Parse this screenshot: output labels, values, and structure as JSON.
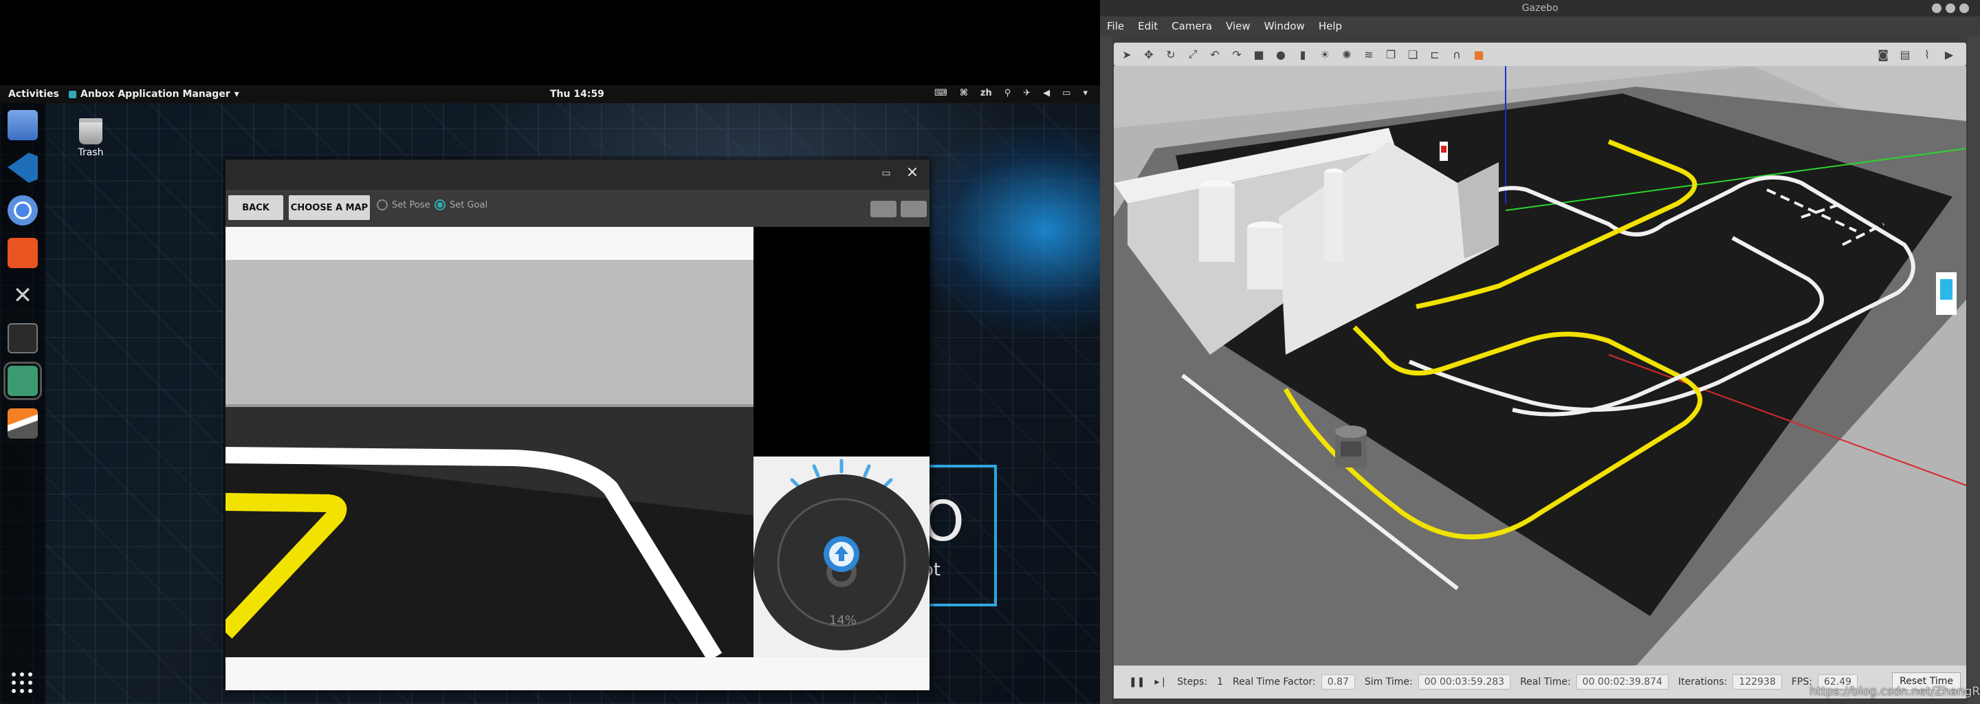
{
  "topbar": {
    "activities": "Activities",
    "app_name": "Anbox Application Manager",
    "clock": "Thu 14:59",
    "lang": "zh"
  },
  "desktop": {
    "trash_label": "Trash",
    "bg_letter": "O",
    "bg_sub": "ot"
  },
  "dock": {
    "items": [
      "files-icon",
      "vscode-icon",
      "chromium-icon",
      "software-center-icon",
      "tools-icon",
      "terminal-icon",
      "android-icon",
      "stack-icon"
    ]
  },
  "anbox": {
    "back": "BACK",
    "choose_map": "CHOOSE A MAP",
    "set_pose": "Set Pose",
    "set_goal": "Set Goal",
    "speed": "14%"
  },
  "gazebo": {
    "title": "Gazebo",
    "menu": [
      "File",
      "Edit",
      "Camera",
      "View",
      "Window",
      "Help"
    ],
    "status": {
      "steps_label": "Steps:",
      "steps_value": "1",
      "rtf_label": "Real Time Factor:",
      "rtf_value": "0.87",
      "sim_label": "Sim Time:",
      "sim_value": "00 00:03:59.283",
      "real_label": "Real Time:",
      "real_value": "00 00:02:39.874",
      "iter_label": "Iterations:",
      "iter_value": "122938",
      "fps_label": "FPS:",
      "fps_value": "62.49",
      "reset": "Reset Time"
    }
  },
  "watermark": "https://blog.csdn.net/ZhangRelay",
  "colors": {
    "accent": "#2ea6e0",
    "track_yellow": "#f2e200",
    "ground": "#1b1b1b"
  }
}
